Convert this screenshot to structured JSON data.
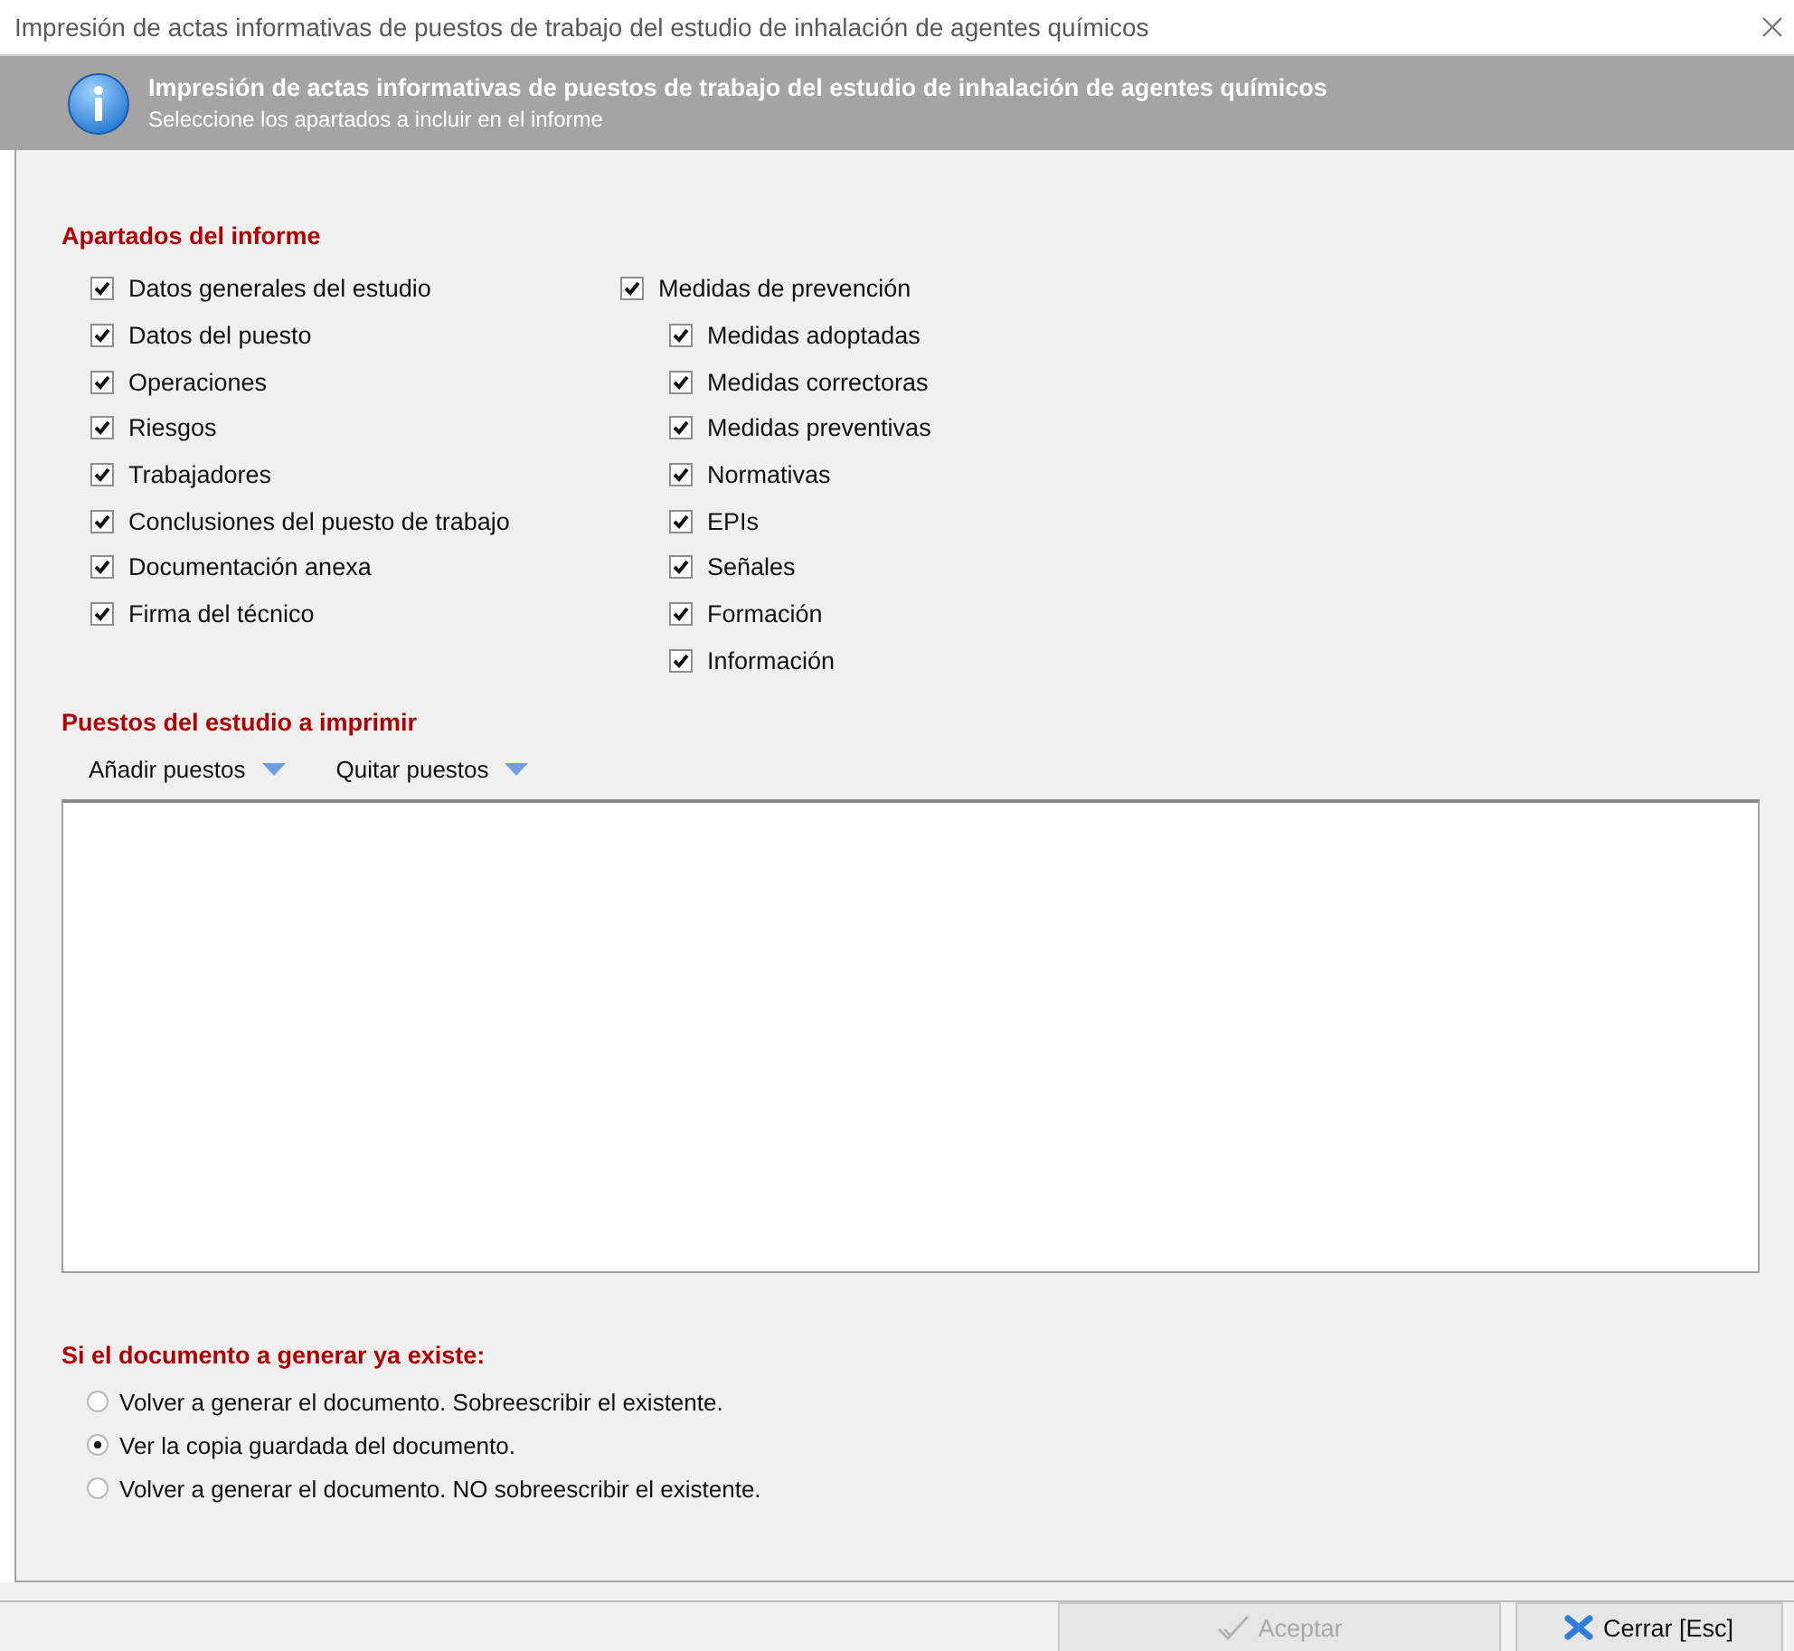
{
  "window": {
    "title": "Impresión de actas informativas de puestos de trabajo del estudio de inhalación de agentes químicos"
  },
  "header": {
    "title": "Impresión de actas informativas de puestos de trabajo del estudio de inhalación de agentes químicos",
    "subtitle": "Seleccione los apartados a incluir en el informe"
  },
  "report_sections": {
    "heading": "Apartados del informe",
    "columns": [
      {
        "items": [
          {
            "label": "Datos generales del estudio",
            "checked": true
          },
          {
            "label": "Datos del puesto",
            "checked": true
          },
          {
            "label": "Operaciones",
            "checked": true
          },
          {
            "label": "Riesgos",
            "checked": true
          },
          {
            "label": "Trabajadores",
            "checked": true
          },
          {
            "label": "Conclusiones del puesto de trabajo",
            "checked": true
          },
          {
            "label": "Documentación anexa",
            "checked": true
          },
          {
            "label": "Firma del técnico",
            "checked": true
          }
        ]
      },
      {
        "items": [
          {
            "label": "Medidas de prevención",
            "checked": true,
            "children": [
              {
                "label": "Medidas adoptadas",
                "checked": true
              },
              {
                "label": "Medidas correctoras",
                "checked": true
              },
              {
                "label": "Medidas preventivas",
                "checked": true
              },
              {
                "label": "Normativas",
                "checked": true
              },
              {
                "label": "EPIs",
                "checked": true
              },
              {
                "label": "Señales",
                "checked": true
              },
              {
                "label": "Formación",
                "checked": true
              },
              {
                "label": "Información",
                "checked": true
              }
            ]
          }
        ]
      }
    ]
  },
  "positions": {
    "heading": "Puestos del estudio a imprimir",
    "toolbar": [
      {
        "label": "Añadir puestos",
        "kind": "dropdown"
      },
      {
        "label": "Quitar puestos",
        "kind": "dropdown"
      }
    ]
  },
  "existing_document": {
    "heading": "Si el documento a generar ya existe:",
    "options": [
      {
        "label": "Volver a generar el documento. Sobreescribir el existente.",
        "selected": false
      },
      {
        "label": "Ver la copia guardada del documento.",
        "selected": true
      },
      {
        "label": "Volver a generar el documento. NO sobreescribir el existente.",
        "selected": false
      }
    ]
  },
  "buttons": [
    {
      "label": "Aceptar",
      "kind": "accept",
      "disabled": true
    },
    {
      "label": "Cerrar [Esc]",
      "kind": "close",
      "disabled": false
    }
  ]
}
